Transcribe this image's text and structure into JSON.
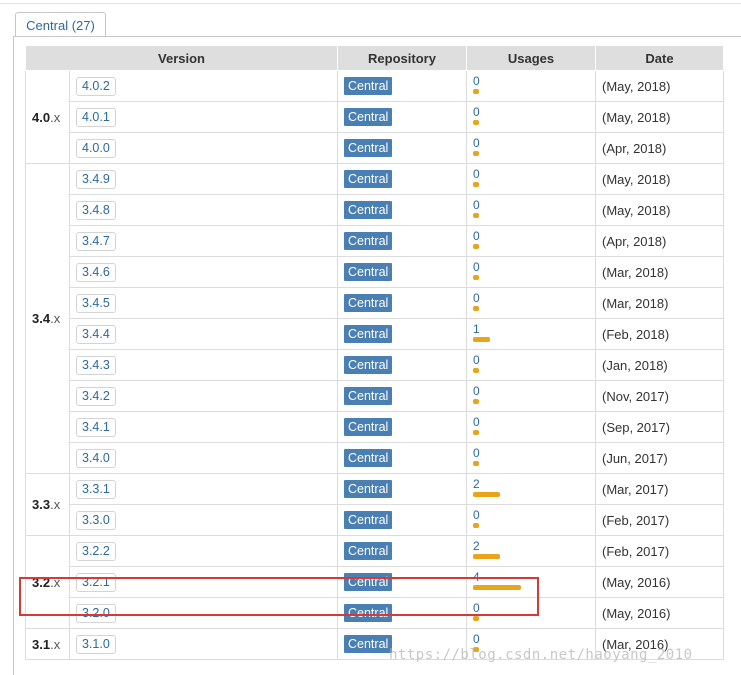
{
  "tab": {
    "label": "Central (27)"
  },
  "table": {
    "headers": {
      "version": "Version",
      "repository": "Repository",
      "usages": "Usages",
      "date": "Date"
    },
    "groups": [
      {
        "major": "4.0",
        "suffix": ".x",
        "rows": [
          {
            "version": "4.0.2",
            "repo": "Central",
            "usages": "0",
            "usage_level": 0.0,
            "date": "(May, 2018)"
          },
          {
            "version": "4.0.1",
            "repo": "Central",
            "usages": "0",
            "usage_level": 0.0,
            "date": "(May, 2018)"
          },
          {
            "version": "4.0.0",
            "repo": "Central",
            "usages": "0",
            "usage_level": 0.0,
            "date": "(Apr, 2018)"
          }
        ]
      },
      {
        "major": "3.4",
        "suffix": ".x",
        "rows": [
          {
            "version": "3.4.9",
            "repo": "Central",
            "usages": "0",
            "usage_level": 0.0,
            "date": "(May, 2018)"
          },
          {
            "version": "3.4.8",
            "repo": "Central",
            "usages": "0",
            "usage_level": 0.0,
            "date": "(May, 2018)"
          },
          {
            "version": "3.4.7",
            "repo": "Central",
            "usages": "0",
            "usage_level": 0.0,
            "date": "(Apr, 2018)"
          },
          {
            "version": "3.4.6",
            "repo": "Central",
            "usages": "0",
            "usage_level": 0.0,
            "date": "(Mar, 2018)"
          },
          {
            "version": "3.4.5",
            "repo": "Central",
            "usages": "0",
            "usage_level": 0.0,
            "date": "(Mar, 2018)"
          },
          {
            "version": "3.4.4",
            "repo": "Central",
            "usages": "1",
            "usage_level": 0.25,
            "date": "(Feb, 2018)"
          },
          {
            "version": "3.4.3",
            "repo": "Central",
            "usages": "0",
            "usage_level": 0.0,
            "date": "(Jan, 2018)"
          },
          {
            "version": "3.4.2",
            "repo": "Central",
            "usages": "0",
            "usage_level": 0.0,
            "date": "(Nov, 2017)"
          },
          {
            "version": "3.4.1",
            "repo": "Central",
            "usages": "0",
            "usage_level": 0.0,
            "date": "(Sep, 2017)"
          },
          {
            "version": "3.4.0",
            "repo": "Central",
            "usages": "0",
            "usage_level": 0.0,
            "date": "(Jun, 2017)"
          }
        ]
      },
      {
        "major": "3.3",
        "suffix": ".x",
        "rows": [
          {
            "version": "3.3.1",
            "repo": "Central",
            "usages": "2",
            "usage_level": 0.5,
            "date": "(Mar, 2017)"
          },
          {
            "version": "3.3.0",
            "repo": "Central",
            "usages": "0",
            "usage_level": 0.0,
            "date": "(Feb, 2017)"
          }
        ]
      },
      {
        "major": "3.2",
        "suffix": ".x",
        "rows": [
          {
            "version": "3.2.2",
            "repo": "Central",
            "usages": "2",
            "usage_level": 0.5,
            "date": "(Feb, 2017)"
          },
          {
            "version": "3.2.1",
            "repo": "Central",
            "usages": "4",
            "usage_level": 1.0,
            "date": "(May, 2016)",
            "highlighted": true
          },
          {
            "version": "3.2.0",
            "repo": "Central",
            "usages": "0",
            "usage_level": 0.0,
            "date": "(May, 2016)"
          }
        ]
      },
      {
        "major": "3.1",
        "suffix": ".x",
        "rows": [
          {
            "version": "3.1.0",
            "repo": "Central",
            "usages": "0",
            "usage_level": 0.0,
            "date": "(Mar, 2016)"
          }
        ]
      }
    ]
  },
  "colors": {
    "bar": "#e8a51c",
    "repo_badge": "#4a7fb3",
    "highlight": "#d63a36",
    "link": "#2c6a99"
  },
  "watermark": "https://blog.csdn.net/haoyang_2010"
}
